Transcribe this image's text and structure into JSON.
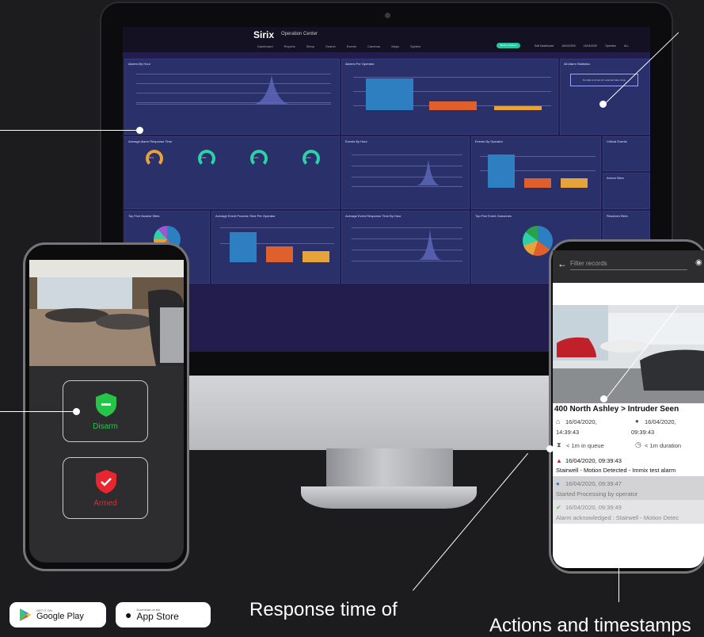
{
  "dashboard": {
    "brand": "Sirix",
    "brand_sub": "Operation Center",
    "nav": [
      "Dashboard",
      "Reports",
      "Setup",
      "Search",
      "Events",
      "Cameras",
      "Maps",
      "System"
    ],
    "overview_button": "Back to System",
    "top_right": [
      "Edit Dashboard",
      "16/04/2020",
      "16/04/2020",
      "Operator",
      "ALL"
    ],
    "panels": {
      "alarms_by_hour": "Alarms By Hour",
      "alarms_per_operator": "Alarms Per Operator",
      "alarm_statistics": "All Alarm Statistics",
      "alarm_statistics_empty": "No data is shown for selected date range",
      "avg_alarm_response": "Average Alarm Response Time",
      "events_by_hour": "Events By Hour",
      "events_by_operator": "Events By Operator",
      "critical_events": "Critical Events",
      "armed_sites": "Armed Sites",
      "top_five_busiest": "Top Five Busiest Sites",
      "avg_event_process": "Average Event Process Time Per Operator",
      "avg_event_response": "Average Event Response Time By Hour",
      "top_five_outcomes": "Top Five Event Outcomes",
      "resolved_sites": "Resolved Sites"
    },
    "gauge_values": [
      "80%",
      "100%",
      "100%",
      "100%"
    ]
  },
  "left_phone": {
    "disarm_label": "Disarm",
    "armed_label": "Armed"
  },
  "right_phone": {
    "filter_placeholder": "Filter records",
    "title": "400 North Ashley > Intruder Seen",
    "date_left": "16/04/2020,",
    "time_left": "14:39:43",
    "date_right": "16/04/2020,",
    "time_right": "09:39:43",
    "queue": "< 1m in queue",
    "duration": "< 1m duration",
    "events": [
      {
        "time": "16/04/2020, 09:39:43",
        "text": "Stairwell - Motion Detected - Immix test alarm"
      },
      {
        "time": "16/04/2020, 09:39:47",
        "text": "Started Processing by operator"
      },
      {
        "time": "16/04/2020, 09:39:49",
        "text": "Alarm acknowledged : Stairwell - Motion Detec"
      }
    ]
  },
  "stores": {
    "google_small": "GET IT ON",
    "google": "Google Play",
    "apple_small": "Download on the",
    "apple": "App Store"
  },
  "captions": {
    "bottom_center": "Response time of",
    "bottom_right": "Actions and timestamps"
  },
  "colors": {
    "dashboard_bg": "#221d4d",
    "panel_bg": "#29306a",
    "accent_teal": "#25c5a0",
    "bar_blue": "#2d7fc1",
    "bar_orange": "#e0602d",
    "bar_amber": "#e8a23a",
    "disarm_green": "#27c44a",
    "armed_red": "#e8262f"
  }
}
